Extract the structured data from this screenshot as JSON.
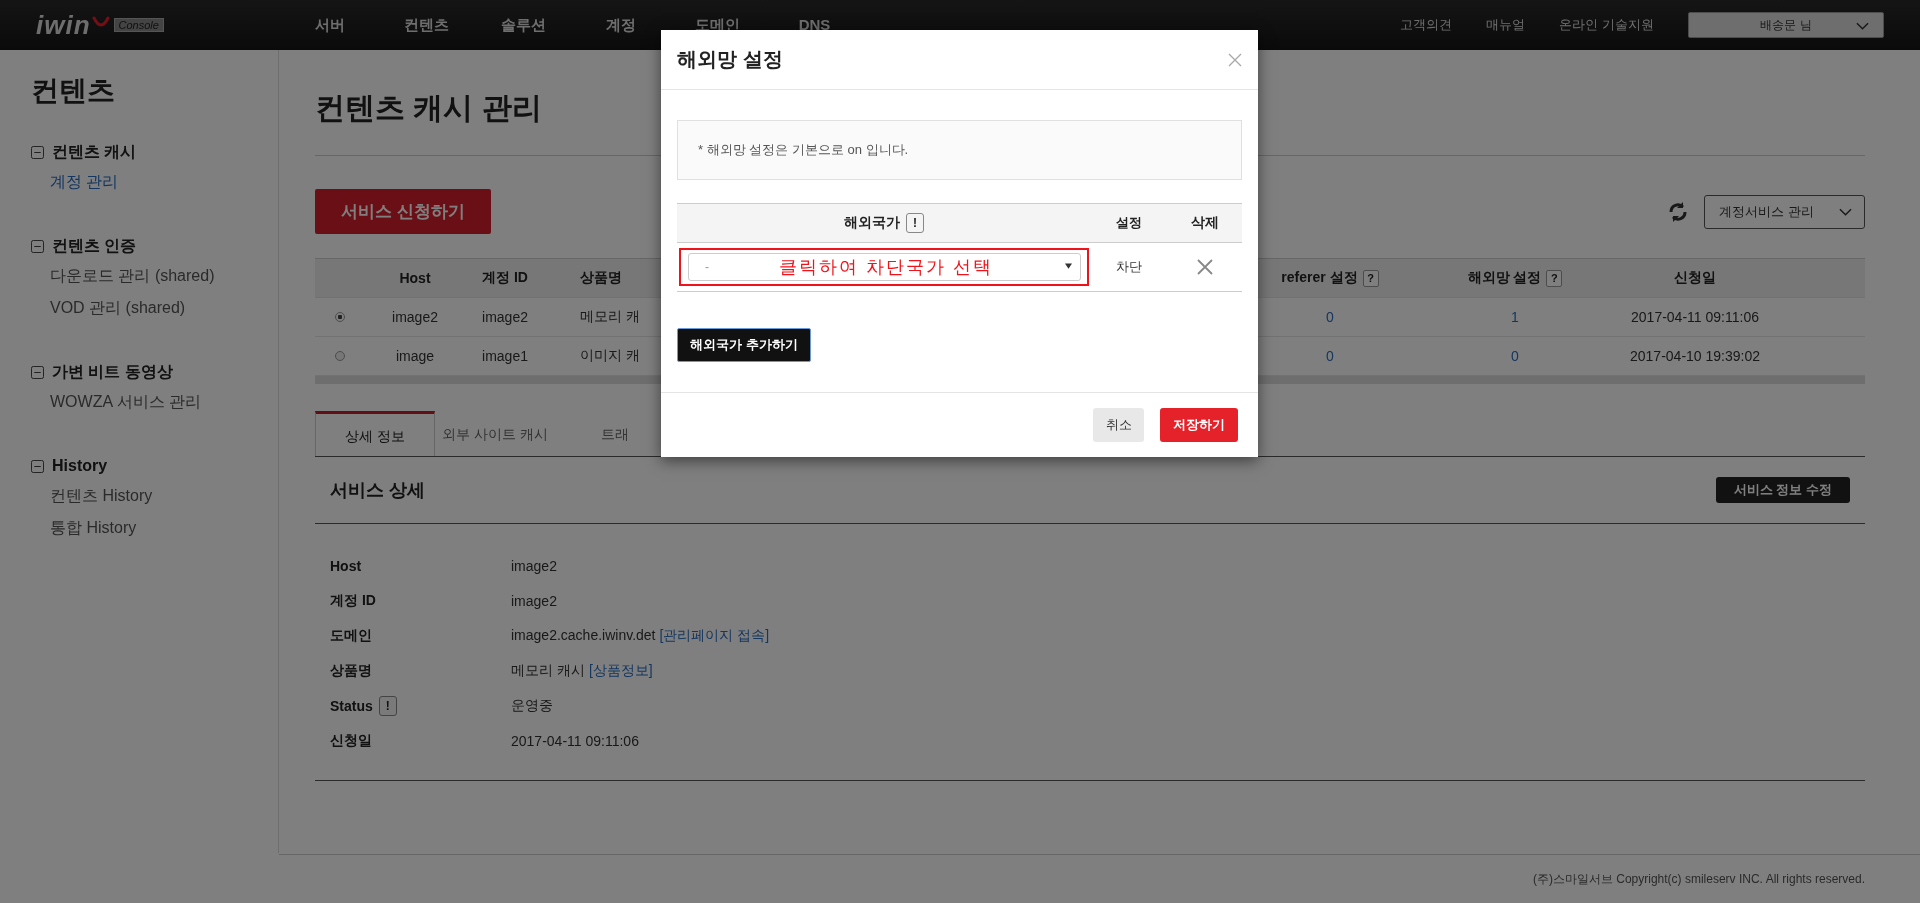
{
  "topbar": {
    "logo": {
      "text": "iwin",
      "badge": "Console"
    },
    "nav": [
      {
        "label": "서버"
      },
      {
        "label": "컨텐츠"
      },
      {
        "label": "솔루션"
      },
      {
        "label": "계정"
      },
      {
        "label": "도메인"
      },
      {
        "label": "DNS"
      }
    ],
    "links": [
      "고객의견",
      "매뉴얼",
      "온라인 기술지원"
    ],
    "user": "배송문 님"
  },
  "sidebar": {
    "title": "컨텐츠",
    "groups": [
      {
        "label": "컨텐츠 캐시",
        "expanded": true,
        "items": [
          {
            "label": "계정 관리",
            "selected": true
          }
        ]
      },
      {
        "label": "컨텐츠 인증",
        "expanded": true,
        "items": [
          {
            "label": "다운로드 관리 (shared)",
            "selected": false
          },
          {
            "label": "VOD 관리 (shared)",
            "selected": false
          }
        ]
      },
      {
        "label": "가변 비트 동영상",
        "expanded": true,
        "items": [
          {
            "label": "WOWZA 서비스 관리",
            "selected": false
          }
        ]
      },
      {
        "label": "History",
        "expanded": true,
        "items": [
          {
            "label": "컨텐츠 History",
            "selected": false
          },
          {
            "label": "통합 History",
            "selected": false
          }
        ]
      }
    ]
  },
  "page": {
    "title": "컨텐츠 캐시 관리",
    "apply_button": "서비스 신청하기",
    "service_select": "계정서비스 관리"
  },
  "table": {
    "columns": [
      {
        "label": "Host"
      },
      {
        "label": "계정 ID"
      },
      {
        "label": "상품명"
      },
      {
        "label": "referer 설정",
        "help": "?"
      },
      {
        "label": "해외망 설정",
        "help": "?"
      },
      {
        "label": "신청일"
      }
    ],
    "rows": [
      {
        "selected": true,
        "host": "image2",
        "account_id": "image2",
        "product": "메모리 캐",
        "referer": "0",
        "overseas": "1",
        "date": "2017-04-11 09:11:06"
      },
      {
        "selected": false,
        "host": "image",
        "account_id": "image1",
        "product": "이미지 캐",
        "referer": "0",
        "overseas": "0",
        "date": "2017-04-10 19:39:02"
      }
    ]
  },
  "tabs": [
    {
      "label": "상세 정보",
      "selected": true
    },
    {
      "label": "외부 사이트 캐시",
      "selected": false
    },
    {
      "label": "트래",
      "selected": false
    }
  ],
  "detail": {
    "title": "서비스 상세",
    "edit_button": "서비스 정보 수정",
    "fields": [
      {
        "label": "Host",
        "value": "image2"
      },
      {
        "label": "계정 ID",
        "value": "image2"
      },
      {
        "label": "도메인",
        "value": "image2.cache.iwinv.det",
        "link": "[관리페이지 접속]"
      },
      {
        "label": "상품명",
        "value": "메모리 캐시",
        "link": "[상품정보]"
      },
      {
        "label": "Status",
        "info": "!",
        "value": "운영중"
      },
      {
        "label": "신청일",
        "value": "2017-04-11 09:11:06"
      }
    ]
  },
  "footer": "(주)스마일서브 Copyright(c) smileserv INC. All rights reserved.",
  "modal": {
    "title": "해외망 설정",
    "notice": "* 해외망 설정은 기본으로 on 입니다.",
    "columns": [
      {
        "label": "해외국가",
        "info": "!"
      },
      {
        "label": "설정"
      },
      {
        "label": "삭제"
      }
    ],
    "rows": [
      {
        "country": "-",
        "annotation": "클릭하여 차단국가 선택",
        "setting": "차단"
      }
    ],
    "add_button": "해외국가 추가하기",
    "cancel_button": "취소",
    "save_button": "저장하기"
  }
}
